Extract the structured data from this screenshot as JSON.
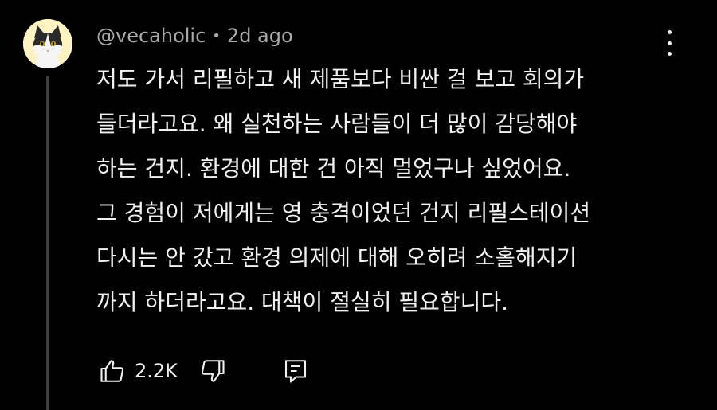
{
  "comment": {
    "author": "@vecaholic",
    "separator": "•",
    "timestamp": "2d ago",
    "lines": [
      "저도 가서 리필하고 새 제품보다 비싼 걸 보고 회의가",
      "들더라고요. 왜 실천하는 사람들이 더 많이 감당해야",
      "하는 건지. 환경에 대한 건 아직 멀었구나 싶었어요.",
      "그 경험이 저에게는 영 충격이었던 건지 리필스테이션",
      "다시는 안 갔고 환경 의제에 대해 오히려 소홀해지기",
      "까지 하더라고요. 대책이 절실히 필요합니다."
    ],
    "like_count": "2.2K"
  },
  "icons": {
    "avatar": "cat-avatar",
    "more": "more-vert-icon",
    "like": "thumbs-up-icon",
    "dislike": "thumbs-down-icon",
    "reply": "reply-icon"
  },
  "colors": {
    "background": "#000000",
    "text": "#f1f1f1",
    "meta": "#aaaaaa",
    "thread_line": "#3d3d3d",
    "avatar_bg": "#fff3c4"
  }
}
